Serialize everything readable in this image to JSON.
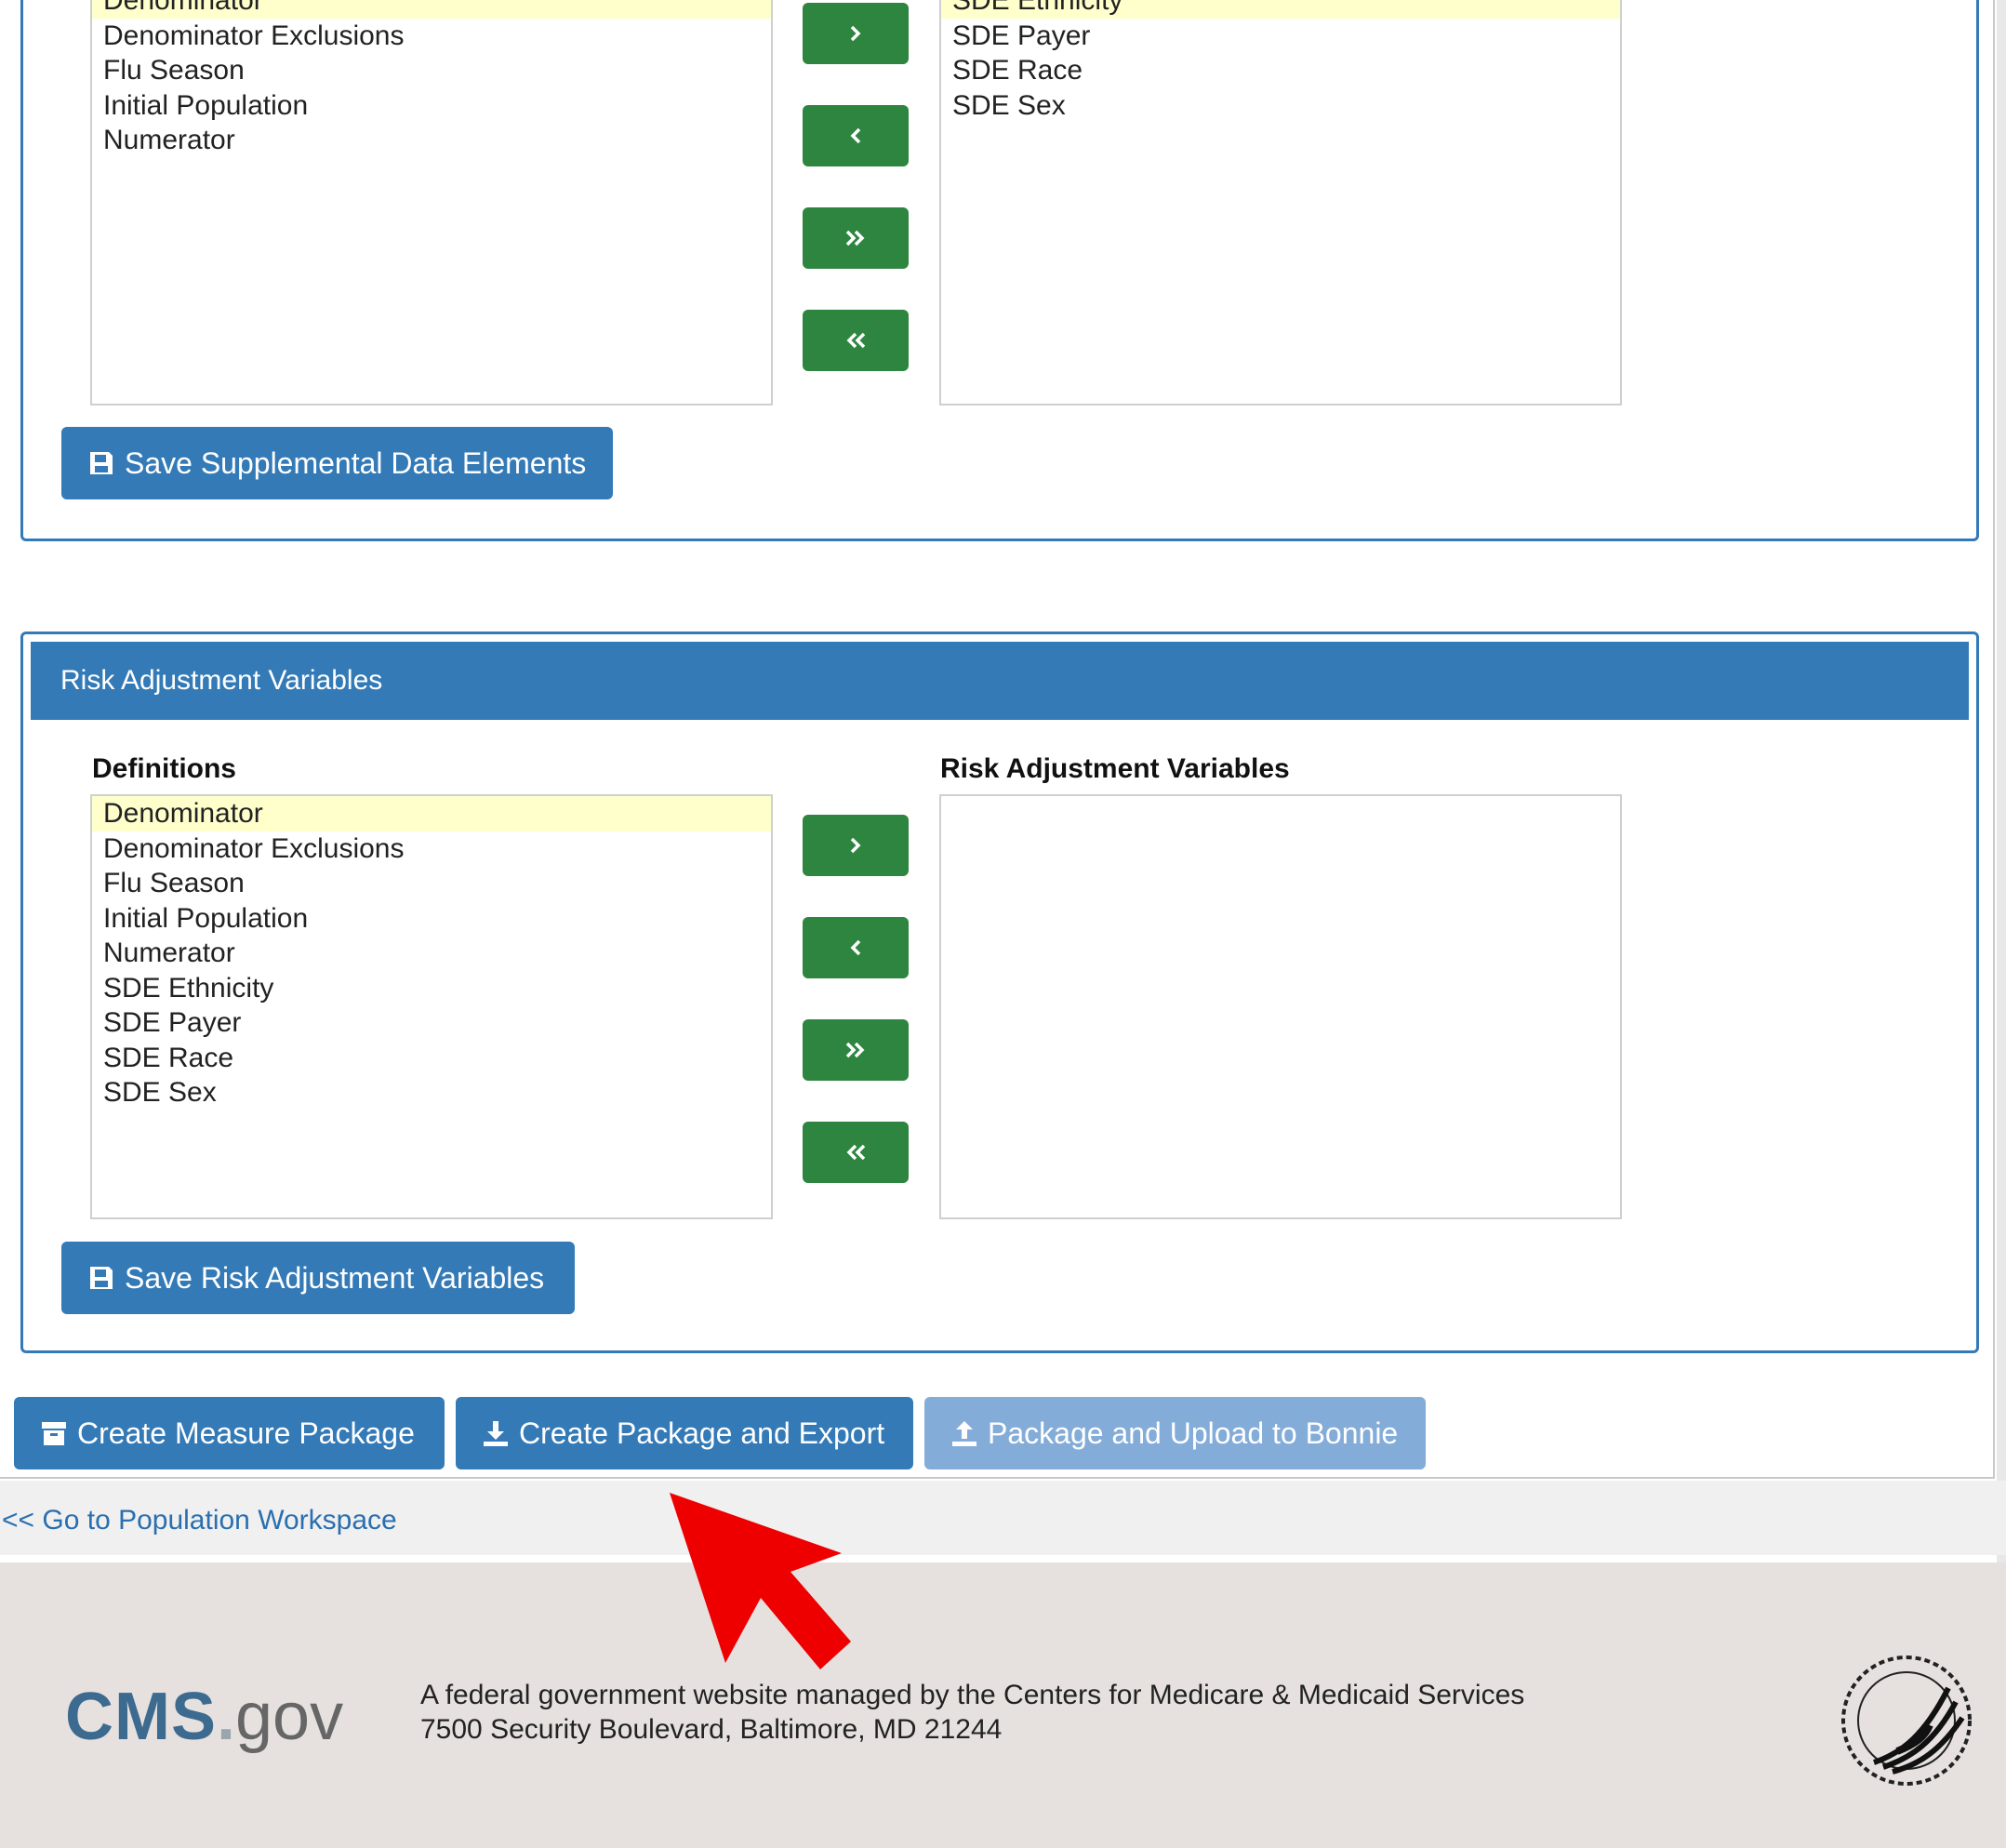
{
  "supplemental": {
    "definitions_items": [
      "Denominator",
      "Denominator Exclusions",
      "Flu Season",
      "Initial Population",
      "Numerator"
    ],
    "selected_items": [
      "SDE Ethnicity",
      "SDE Payer",
      "SDE Race",
      "SDE Sex"
    ],
    "save_label": "Save Supplemental Data Elements"
  },
  "risk": {
    "heading": "Risk Adjustment Variables",
    "definitions_label": "Definitions",
    "variables_label": "Risk Adjustment Variables",
    "definitions_items": [
      "Denominator",
      "Denominator Exclusions",
      "Flu Season",
      "Initial Population",
      "Numerator",
      "SDE Ethnicity",
      "SDE Payer",
      "SDE Race",
      "SDE Sex"
    ],
    "selected_items": [],
    "save_label": "Save Risk Adjustment Variables"
  },
  "transfer_buttons": [
    "move-right",
    "move-left",
    "move-all-right",
    "move-all-left"
  ],
  "actions": {
    "create_package": "Create Measure Package",
    "create_export": "Create Package and Export",
    "upload_bonnie": "Package and Upload to Bonnie"
  },
  "back_link": "<< Go to Population Workspace",
  "footer": {
    "logo_cms": "CMS",
    "logo_dot": ".",
    "logo_gov": "gov",
    "line1": "A federal government website managed by the Centers for Medicare & Medicaid Services",
    "line2": "7500 Security Boulevard, Baltimore, MD 21244"
  },
  "colors": {
    "primary": "#337ab7",
    "success": "#2e8540",
    "highlight": "#ffffcc",
    "annotation_arrow": "#ee0000"
  }
}
